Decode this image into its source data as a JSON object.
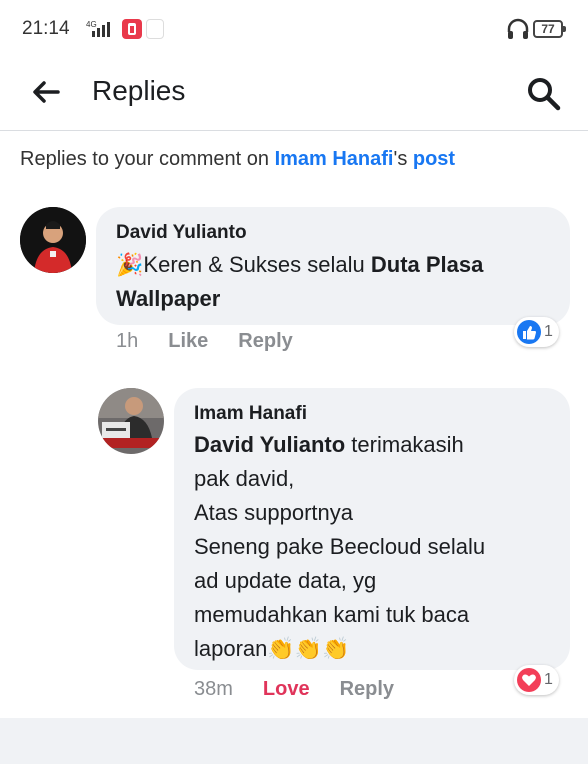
{
  "status_bar": {
    "time": "21:14",
    "network": "4G",
    "battery": "77"
  },
  "header": {
    "title": "Replies"
  },
  "context": {
    "prefix": "Replies to your comment on ",
    "name": "Imam Hanafi",
    "suffix": "'s ",
    "post": "post"
  },
  "comments": [
    {
      "author": "David Yulianto",
      "emoji": "🎉",
      "text_plain": "Keren & Sukses selalu ",
      "text_bold": "Duta Plasa",
      "text_bold2": "Wallpaper",
      "time": "1h",
      "action1": "Like",
      "action2": "Reply",
      "reaction_count": "1",
      "reaction_type": "like"
    },
    {
      "author": "Imam Hanafi",
      "mention": "David Yulianto",
      "line1_rest": " terimakasih",
      "line2": "pak david,",
      "line3": "Atas supportnya",
      "line4": "Seneng pake Beecloud selalu",
      "line5": "ad update data, yg",
      "line6": "memudahkan kami tuk baca",
      "line7": "laporan",
      "emoji": "👏👏👏",
      "time": "38m",
      "action1": "Love",
      "action2": "Reply",
      "reaction_count": "1",
      "reaction_type": "love"
    }
  ],
  "colors": {
    "accent": "#1877f2",
    "bubble": "#f0f2f5",
    "love": "#e0345a"
  }
}
